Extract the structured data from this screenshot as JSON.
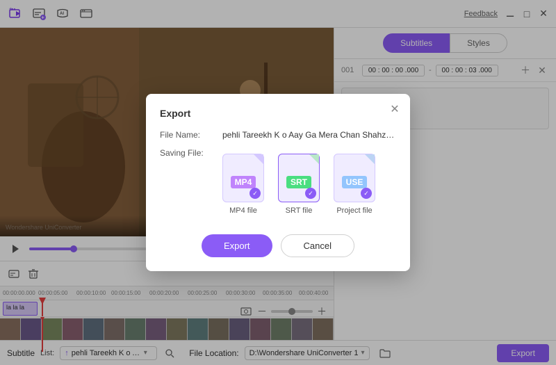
{
  "toolbar": {
    "feedback_label": "Feedback",
    "icons": [
      "add-video-icon",
      "add-subtitle-icon",
      "ai-subtitle-icon",
      "settings-icon"
    ]
  },
  "tabs": {
    "subtitles": "Subtitles",
    "styles": "Styles"
  },
  "subtitle_entry": {
    "number": "001",
    "start_time": "00 : 00 : 00 .000",
    "end_time": "00 : 00 : 03 .000",
    "text": "la la la"
  },
  "timeline": {
    "ruler_marks": [
      "00:00:00.000",
      "00:00:05:00",
      "00:00:10:00",
      "00:00:15:00",
      "00:00:20:00",
      "00:00:25:00",
      "00:00:30:00",
      "00:00:35:00",
      "00:00:40:00"
    ],
    "subtitle_clip_text": "la la la",
    "playhead_position": "60px"
  },
  "modal": {
    "title": "Export",
    "file_name_label": "File Name:",
    "file_name_value": "pehli Tareekh K o Aay Ga Mera Chan Shahzada Attaullah ▶",
    "saving_file_label": "Saving File:",
    "file_options": [
      {
        "label": "MP4",
        "type": "mp4",
        "name": "MP4 file",
        "selected": true
      },
      {
        "label": "SRT",
        "type": "srt",
        "name": "SRT file",
        "selected": true
      },
      {
        "label": "USE",
        "type": "use",
        "name": "Project file",
        "selected": true
      }
    ],
    "export_btn": "Export",
    "cancel_btn": "Cancel"
  },
  "bottom_bar": {
    "subtitle_label": "Subtitle",
    "subtitle_list_label": "Subtitle List:",
    "subtitle_list_value": "↑ pehli Tareekh K o Aay ...",
    "file_location_label": "File Location:",
    "file_location_value": "D:\\Wondershare UniConverter 1",
    "export_btn": "Export"
  }
}
